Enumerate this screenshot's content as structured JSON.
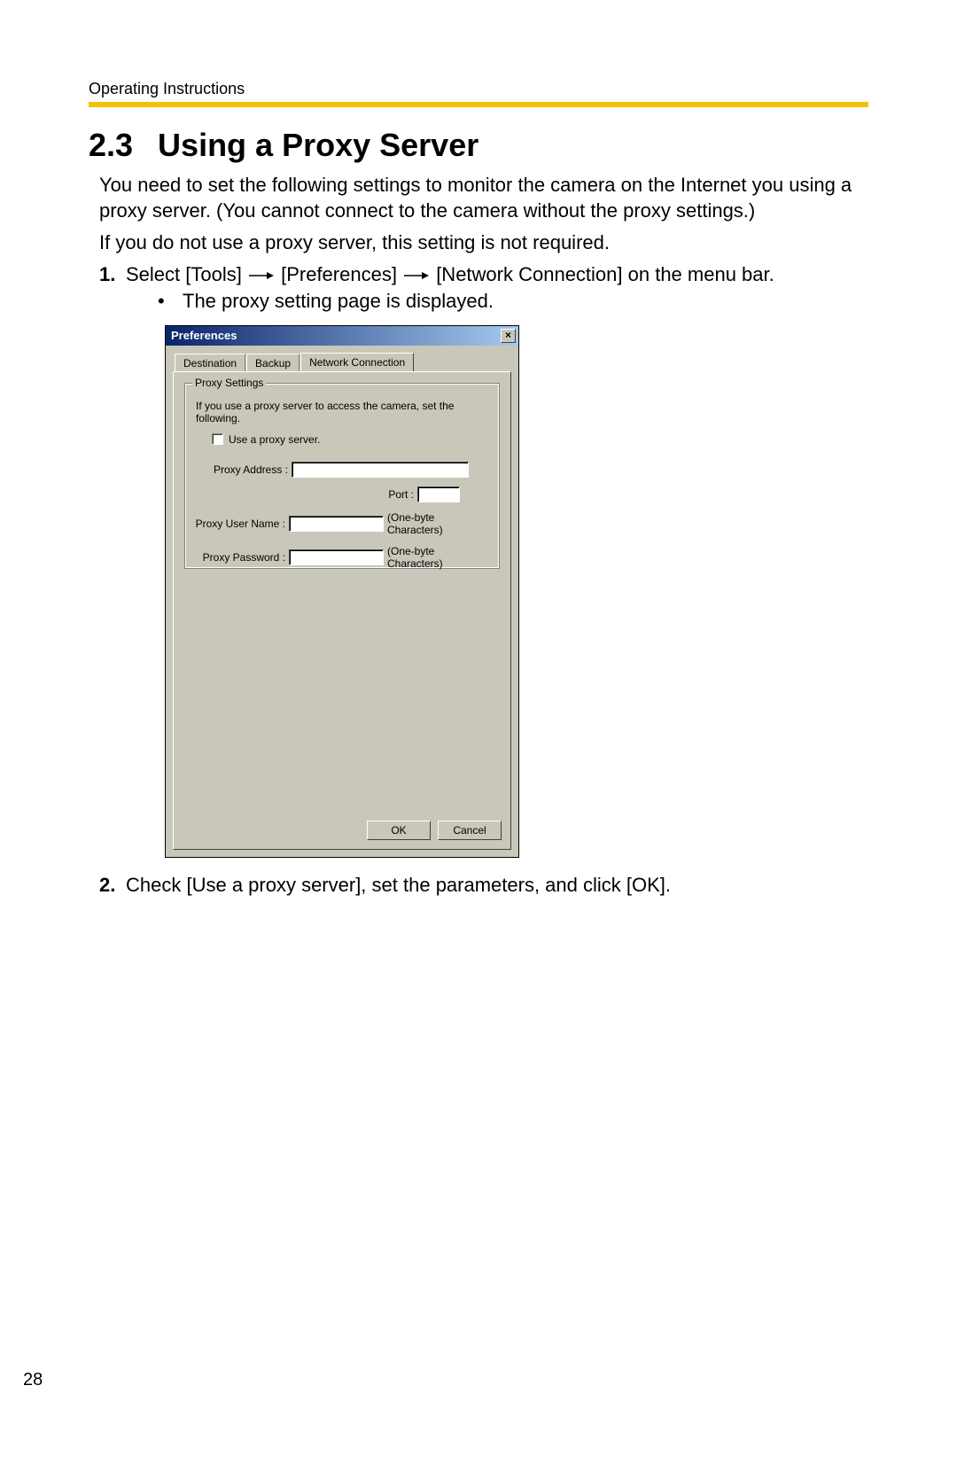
{
  "doc": {
    "running_head": "Operating Instructions",
    "section_number": "2.3",
    "section_title": "Using a Proxy Server",
    "para1": "You need to set the following settings to monitor the camera on the Internet you using a proxy server. (You cannot connect to the camera without the proxy settings.)",
    "para2": "If you do not use a proxy server, this setting is not required.",
    "step1_num": "1.",
    "step1_a": "Select [Tools]",
    "step1_b": "[Preferences]",
    "step1_c": "[Network Connection] on the menu bar.",
    "step1_bullet": "The proxy setting page is displayed.",
    "step2_num": "2.",
    "step2": "Check [Use a proxy server], set the parameters, and click [OK].",
    "page_number": "28"
  },
  "dialog": {
    "title": "Preferences",
    "tabs": [
      "Destination",
      "Backup",
      "Network Connection"
    ],
    "fieldset_legend": "Proxy Settings",
    "instruction": "If you use a proxy server to access the camera, set the following.",
    "checkbox_label": "Use a proxy server.",
    "labels": {
      "proxy_address": "Proxy Address :",
      "port": "Port :",
      "proxy_user": "Proxy User Name :",
      "proxy_password": "Proxy Password :"
    },
    "hint": "(One-byte Characters)",
    "buttons": {
      "ok": "OK",
      "cancel": "Cancel"
    }
  }
}
